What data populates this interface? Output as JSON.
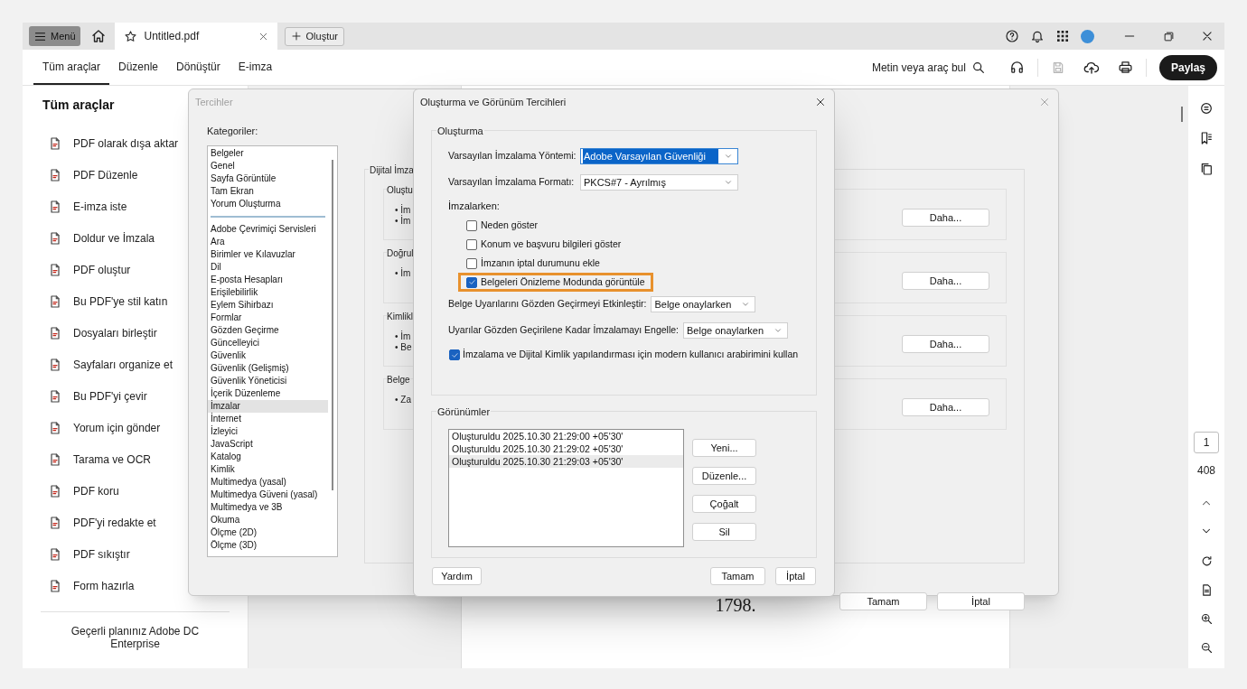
{
  "title_bar": {
    "menu_button": "Menü",
    "tabs": [
      {
        "label": "Untitled.pdf",
        "selected": true
      }
    ],
    "create_button": "Oluştur"
  },
  "toolbar": {
    "tabs": [
      {
        "label": "Tüm araçlar",
        "selected": true
      },
      {
        "label": "Düzenle",
        "selected": false
      },
      {
        "label": "Dönüştür",
        "selected": false
      },
      {
        "label": "E-imza",
        "selected": false
      }
    ],
    "search": "Metin veya araç bul",
    "save_disabled": true,
    "share_button": "Paylaş"
  },
  "tools_panel": {
    "title": "Tüm araçlar",
    "items": [
      "PDF olarak dışa aktar",
      "PDF Düzenle",
      "E-imza iste",
      "Doldur ve İmzala",
      "PDF oluştur",
      "Bu PDF'ye stil katın",
      "Dosyaları birleştir",
      "Sayfaları organize et",
      "Bu PDF'yi çevir",
      "Yorum için gönder",
      "Tarama ve OCR",
      "PDF koru",
      "PDF'yi redakte et",
      "PDF sıkıştır",
      "Form hazırla"
    ],
    "plan": "Geçerli planınız Adobe DC Enterprise"
  },
  "document": {
    "visible_text": "1798."
  },
  "page_nav": {
    "current_page": "1",
    "page_count": "408"
  },
  "preferences_dialog": {
    "title": "Tercihler",
    "categories_label": "Kategoriler:",
    "category_groups": [
      [
        {
          "label": "Belgeler",
          "selected": false
        },
        {
          "label": "Genel",
          "selected": false
        },
        {
          "label": "Sayfa Görüntüle",
          "selected": false
        },
        {
          "label": "Tam Ekran",
          "selected": false
        },
        {
          "label": "Yorum Oluşturma",
          "selected": false
        }
      ],
      [
        {
          "label": "Adobe Çevrimiçi Servisleri",
          "selected": false
        },
        {
          "label": "Ara",
          "selected": false
        },
        {
          "label": "Birimler ve Kılavuzlar",
          "selected": false
        },
        {
          "label": "Dil",
          "selected": false
        },
        {
          "label": "E-posta Hesapları",
          "selected": false
        },
        {
          "label": "Erişilebilirlik",
          "selected": false
        },
        {
          "label": "Eylem Sihirbazı",
          "selected": false
        },
        {
          "label": "Formlar",
          "selected": false
        },
        {
          "label": "Gözden Geçirme",
          "selected": false
        },
        {
          "label": "Güncelleyici",
          "selected": false
        },
        {
          "label": "Güvenlik",
          "selected": false
        },
        {
          "label": "Güvenlik (Gelişmiş)",
          "selected": false
        },
        {
          "label": "Güvenlik Yöneticisi",
          "selected": false
        },
        {
          "label": "İçerik Düzenleme",
          "selected": false
        },
        {
          "label": "İmzalar",
          "selected": true
        },
        {
          "label": "İnternet",
          "selected": false
        },
        {
          "label": "İzleyici",
          "selected": false
        },
        {
          "label": "JavaScript",
          "selected": false
        },
        {
          "label": "Katalog",
          "selected": false
        },
        {
          "label": "Kimlik",
          "selected": false
        },
        {
          "label": "Multimedya (yasal)",
          "selected": false
        },
        {
          "label": "Multimedya Güveni (yasal)",
          "selected": false
        },
        {
          "label": "Multimedya ve 3B",
          "selected": false
        },
        {
          "label": "Okuma",
          "selected": false
        },
        {
          "label": "Ölçme (2D)",
          "selected": false
        },
        {
          "label": "Ölçme (3D)",
          "selected": false
        }
      ]
    ],
    "group_title": "Dijital İmza",
    "sections": [
      {
        "title": "Oluştu",
        "bullets": [
          "• İm",
          "• İm"
        ],
        "button": "Daha..."
      },
      {
        "title": "Doğrul",
        "bullets": [
          "• İm"
        ],
        "button": "Daha..."
      },
      {
        "title": "Kimlikl",
        "bullets": [
          "• İm",
          "• Be"
        ],
        "button": "Daha..."
      },
      {
        "title": "Belge",
        "bullets": [
          "• Za"
        ],
        "button": "Daha..."
      }
    ],
    "buttons": [
      "Tamam",
      "İptal"
    ]
  },
  "creation_dialog": {
    "title": "Oluşturma ve Görünüm Tercihleri",
    "creation_group": {
      "title": "Oluşturma",
      "fields": [
        {
          "label": "Varsayılan İmzalama Yöntemi:",
          "value": "Adobe Varsayılan Güvenliği",
          "focused": true
        },
        {
          "label": "Varsayılan İmzalama Formatı:",
          "value": "PKCS#7 - Ayrılmış",
          "focused": false
        }
      ],
      "signing_label": "İmzalarken:",
      "options": [
        {
          "label": "Neden göster",
          "checked": false,
          "highlighted": false
        },
        {
          "label": "Konum ve başvuru bilgileri göster",
          "checked": false,
          "highlighted": false
        },
        {
          "label": "İmzanın iptal durumunu ekle",
          "checked": false,
          "highlighted": false
        },
        {
          "label": "Belgeleri Önizleme Modunda görüntüle",
          "checked": true,
          "highlighted": true
        }
      ],
      "review_fields": [
        {
          "label": "Belge Uyarılarını Gözden Geçirmeyi Etkinleştir:",
          "value": "Belge onaylarken",
          "focused": false
        },
        {
          "label": "Uyarılar Gözden Geçirilene Kadar İmzalamayı Engelle:",
          "value": "Belge onaylarken",
          "focused": false
        }
      ],
      "modern_ui": {
        "label": "İmzalama ve Dijital Kimlik yapılandırması için modern kullanıcı arabirimini kullan",
        "checked": true
      }
    },
    "appearances_group": {
      "title": "Görünümler",
      "items": [
        {
          "label": "Oluşturuldu 2025.10.30 21:29:00 +05'30'",
          "selected": false
        },
        {
          "label": "Oluşturuldu 2025.10.30 21:29:02 +05'30'",
          "selected": false
        },
        {
          "label": "Oluşturuldu 2025.10.30 21:29:03 +05'30'",
          "selected": true
        }
      ],
      "buttons": [
        "Yeni...",
        "Düzenle...",
        "Çoğalt",
        "Sil"
      ]
    },
    "help_button": "Yardım",
    "buttons": [
      "Tamam",
      "İptal"
    ]
  }
}
